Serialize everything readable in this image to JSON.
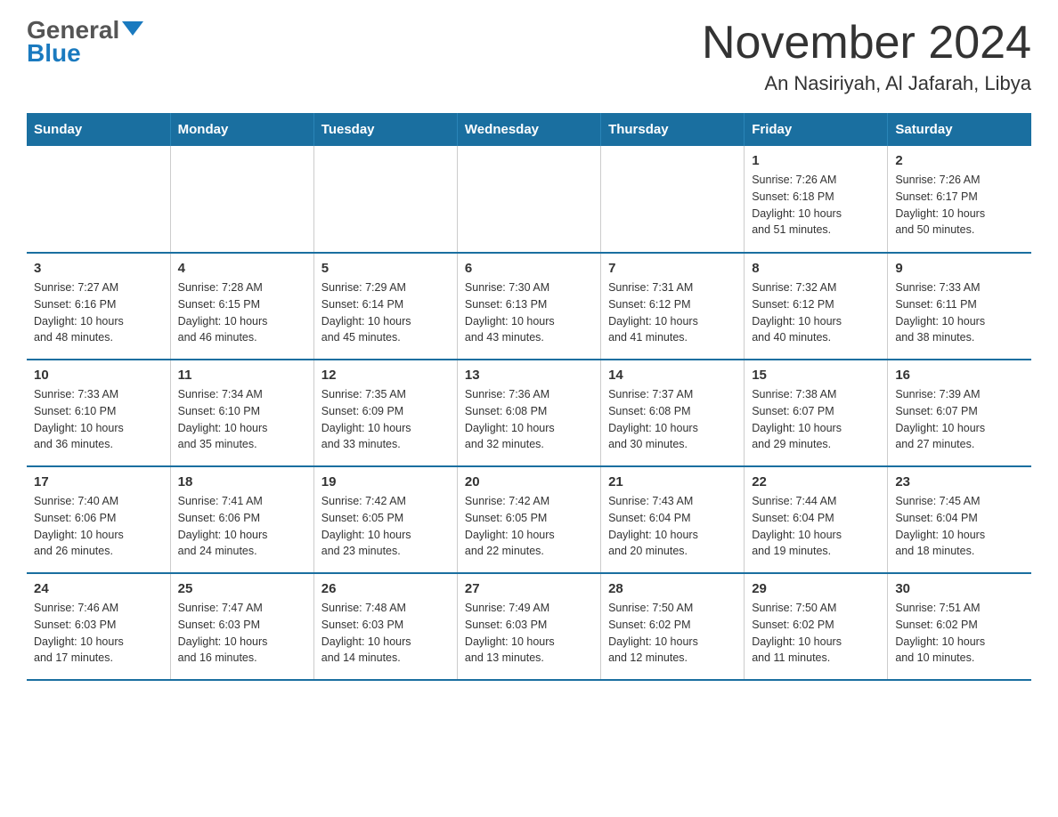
{
  "header": {
    "logo_line1": "General",
    "logo_line2": "Blue",
    "title": "November 2024",
    "subtitle": "An Nasiriyah, Al Jafarah, Libya"
  },
  "days_of_week": [
    "Sunday",
    "Monday",
    "Tuesday",
    "Wednesday",
    "Thursday",
    "Friday",
    "Saturday"
  ],
  "weeks": [
    [
      {
        "day": "",
        "info": ""
      },
      {
        "day": "",
        "info": ""
      },
      {
        "day": "",
        "info": ""
      },
      {
        "day": "",
        "info": ""
      },
      {
        "day": "",
        "info": ""
      },
      {
        "day": "1",
        "info": "Sunrise: 7:26 AM\nSunset: 6:18 PM\nDaylight: 10 hours\nand 51 minutes."
      },
      {
        "day": "2",
        "info": "Sunrise: 7:26 AM\nSunset: 6:17 PM\nDaylight: 10 hours\nand 50 minutes."
      }
    ],
    [
      {
        "day": "3",
        "info": "Sunrise: 7:27 AM\nSunset: 6:16 PM\nDaylight: 10 hours\nand 48 minutes."
      },
      {
        "day": "4",
        "info": "Sunrise: 7:28 AM\nSunset: 6:15 PM\nDaylight: 10 hours\nand 46 minutes."
      },
      {
        "day": "5",
        "info": "Sunrise: 7:29 AM\nSunset: 6:14 PM\nDaylight: 10 hours\nand 45 minutes."
      },
      {
        "day": "6",
        "info": "Sunrise: 7:30 AM\nSunset: 6:13 PM\nDaylight: 10 hours\nand 43 minutes."
      },
      {
        "day": "7",
        "info": "Sunrise: 7:31 AM\nSunset: 6:12 PM\nDaylight: 10 hours\nand 41 minutes."
      },
      {
        "day": "8",
        "info": "Sunrise: 7:32 AM\nSunset: 6:12 PM\nDaylight: 10 hours\nand 40 minutes."
      },
      {
        "day": "9",
        "info": "Sunrise: 7:33 AM\nSunset: 6:11 PM\nDaylight: 10 hours\nand 38 minutes."
      }
    ],
    [
      {
        "day": "10",
        "info": "Sunrise: 7:33 AM\nSunset: 6:10 PM\nDaylight: 10 hours\nand 36 minutes."
      },
      {
        "day": "11",
        "info": "Sunrise: 7:34 AM\nSunset: 6:10 PM\nDaylight: 10 hours\nand 35 minutes."
      },
      {
        "day": "12",
        "info": "Sunrise: 7:35 AM\nSunset: 6:09 PM\nDaylight: 10 hours\nand 33 minutes."
      },
      {
        "day": "13",
        "info": "Sunrise: 7:36 AM\nSunset: 6:08 PM\nDaylight: 10 hours\nand 32 minutes."
      },
      {
        "day": "14",
        "info": "Sunrise: 7:37 AM\nSunset: 6:08 PM\nDaylight: 10 hours\nand 30 minutes."
      },
      {
        "day": "15",
        "info": "Sunrise: 7:38 AM\nSunset: 6:07 PM\nDaylight: 10 hours\nand 29 minutes."
      },
      {
        "day": "16",
        "info": "Sunrise: 7:39 AM\nSunset: 6:07 PM\nDaylight: 10 hours\nand 27 minutes."
      }
    ],
    [
      {
        "day": "17",
        "info": "Sunrise: 7:40 AM\nSunset: 6:06 PM\nDaylight: 10 hours\nand 26 minutes."
      },
      {
        "day": "18",
        "info": "Sunrise: 7:41 AM\nSunset: 6:06 PM\nDaylight: 10 hours\nand 24 minutes."
      },
      {
        "day": "19",
        "info": "Sunrise: 7:42 AM\nSunset: 6:05 PM\nDaylight: 10 hours\nand 23 minutes."
      },
      {
        "day": "20",
        "info": "Sunrise: 7:42 AM\nSunset: 6:05 PM\nDaylight: 10 hours\nand 22 minutes."
      },
      {
        "day": "21",
        "info": "Sunrise: 7:43 AM\nSunset: 6:04 PM\nDaylight: 10 hours\nand 20 minutes."
      },
      {
        "day": "22",
        "info": "Sunrise: 7:44 AM\nSunset: 6:04 PM\nDaylight: 10 hours\nand 19 minutes."
      },
      {
        "day": "23",
        "info": "Sunrise: 7:45 AM\nSunset: 6:04 PM\nDaylight: 10 hours\nand 18 minutes."
      }
    ],
    [
      {
        "day": "24",
        "info": "Sunrise: 7:46 AM\nSunset: 6:03 PM\nDaylight: 10 hours\nand 17 minutes."
      },
      {
        "day": "25",
        "info": "Sunrise: 7:47 AM\nSunset: 6:03 PM\nDaylight: 10 hours\nand 16 minutes."
      },
      {
        "day": "26",
        "info": "Sunrise: 7:48 AM\nSunset: 6:03 PM\nDaylight: 10 hours\nand 14 minutes."
      },
      {
        "day": "27",
        "info": "Sunrise: 7:49 AM\nSunset: 6:03 PM\nDaylight: 10 hours\nand 13 minutes."
      },
      {
        "day": "28",
        "info": "Sunrise: 7:50 AM\nSunset: 6:02 PM\nDaylight: 10 hours\nand 12 minutes."
      },
      {
        "day": "29",
        "info": "Sunrise: 7:50 AM\nSunset: 6:02 PM\nDaylight: 10 hours\nand 11 minutes."
      },
      {
        "day": "30",
        "info": "Sunrise: 7:51 AM\nSunset: 6:02 PM\nDaylight: 10 hours\nand 10 minutes."
      }
    ]
  ]
}
